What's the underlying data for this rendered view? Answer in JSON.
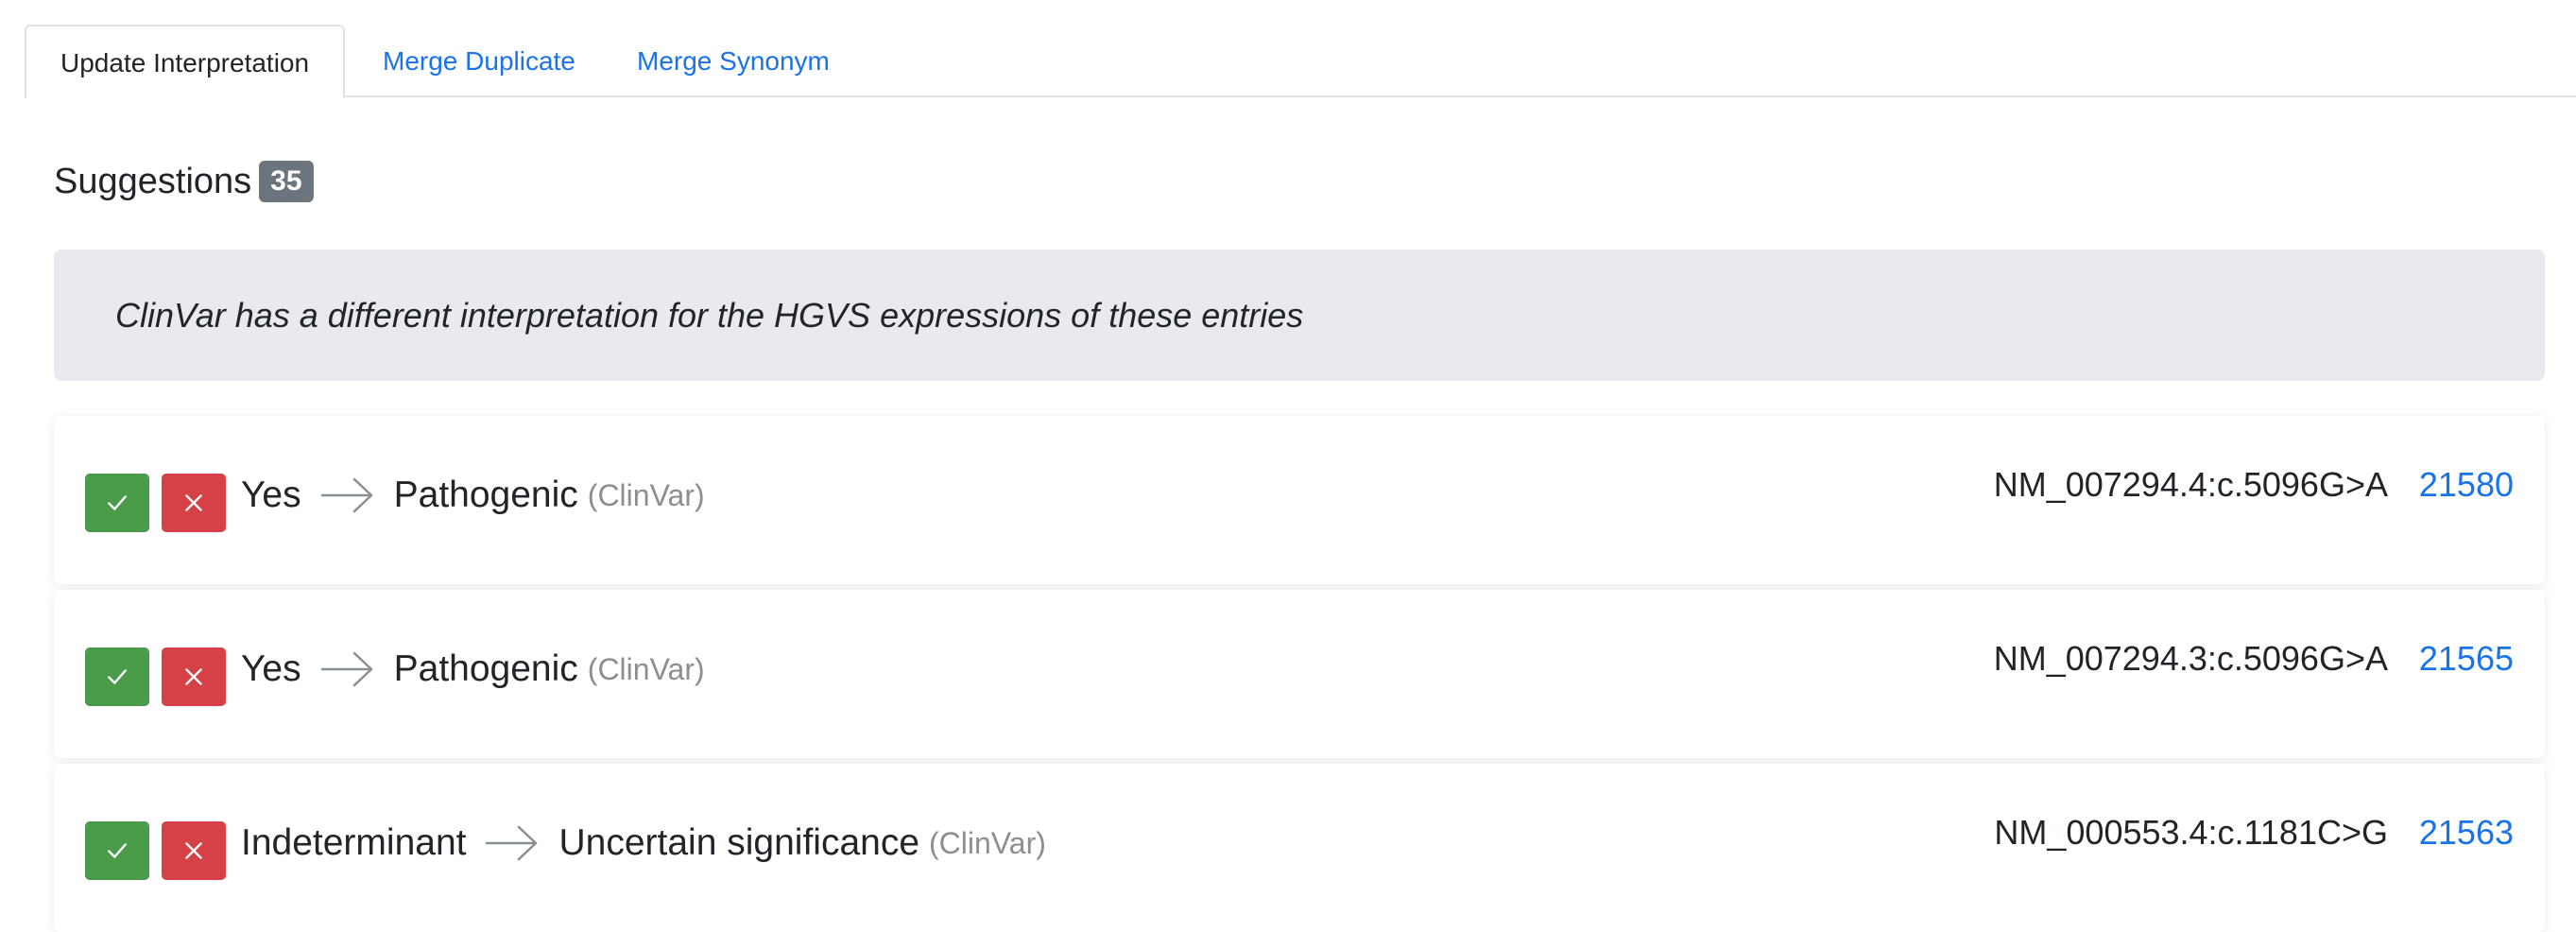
{
  "tabs": [
    {
      "label": "Update Interpretation",
      "active": true
    },
    {
      "label": "Merge Duplicate",
      "active": false
    },
    {
      "label": "Merge Synonym",
      "active": false
    }
  ],
  "suggestions": {
    "title": "Suggestions",
    "count": "35"
  },
  "info_message": "ClinVar has a different interpretation for the HGVS expressions of these entries",
  "items": [
    {
      "from": "Yes",
      "to": "Pathogenic",
      "source": "(ClinVar)",
      "hgvs": "NM_007294.4:c.5096G>A",
      "entry_id": "21580"
    },
    {
      "from": "Yes",
      "to": "Pathogenic",
      "source": "(ClinVar)",
      "hgvs": "NM_007294.3:c.5096G>A",
      "entry_id": "21565"
    },
    {
      "from": "Indeterminant",
      "to": "Uncertain significance",
      "source": "(ClinVar)",
      "hgvs": "NM_000553.4:c.1181C>G",
      "entry_id": "21563"
    }
  ],
  "icons": {
    "accept": "check-icon",
    "reject": "close-icon",
    "arrow": "arrow-right-icon"
  },
  "colors": {
    "accept": "#4a9c4a",
    "reject": "#d54147",
    "link": "#1a73e8",
    "badge": "#6c757d",
    "info_bg": "#e9eaee"
  }
}
